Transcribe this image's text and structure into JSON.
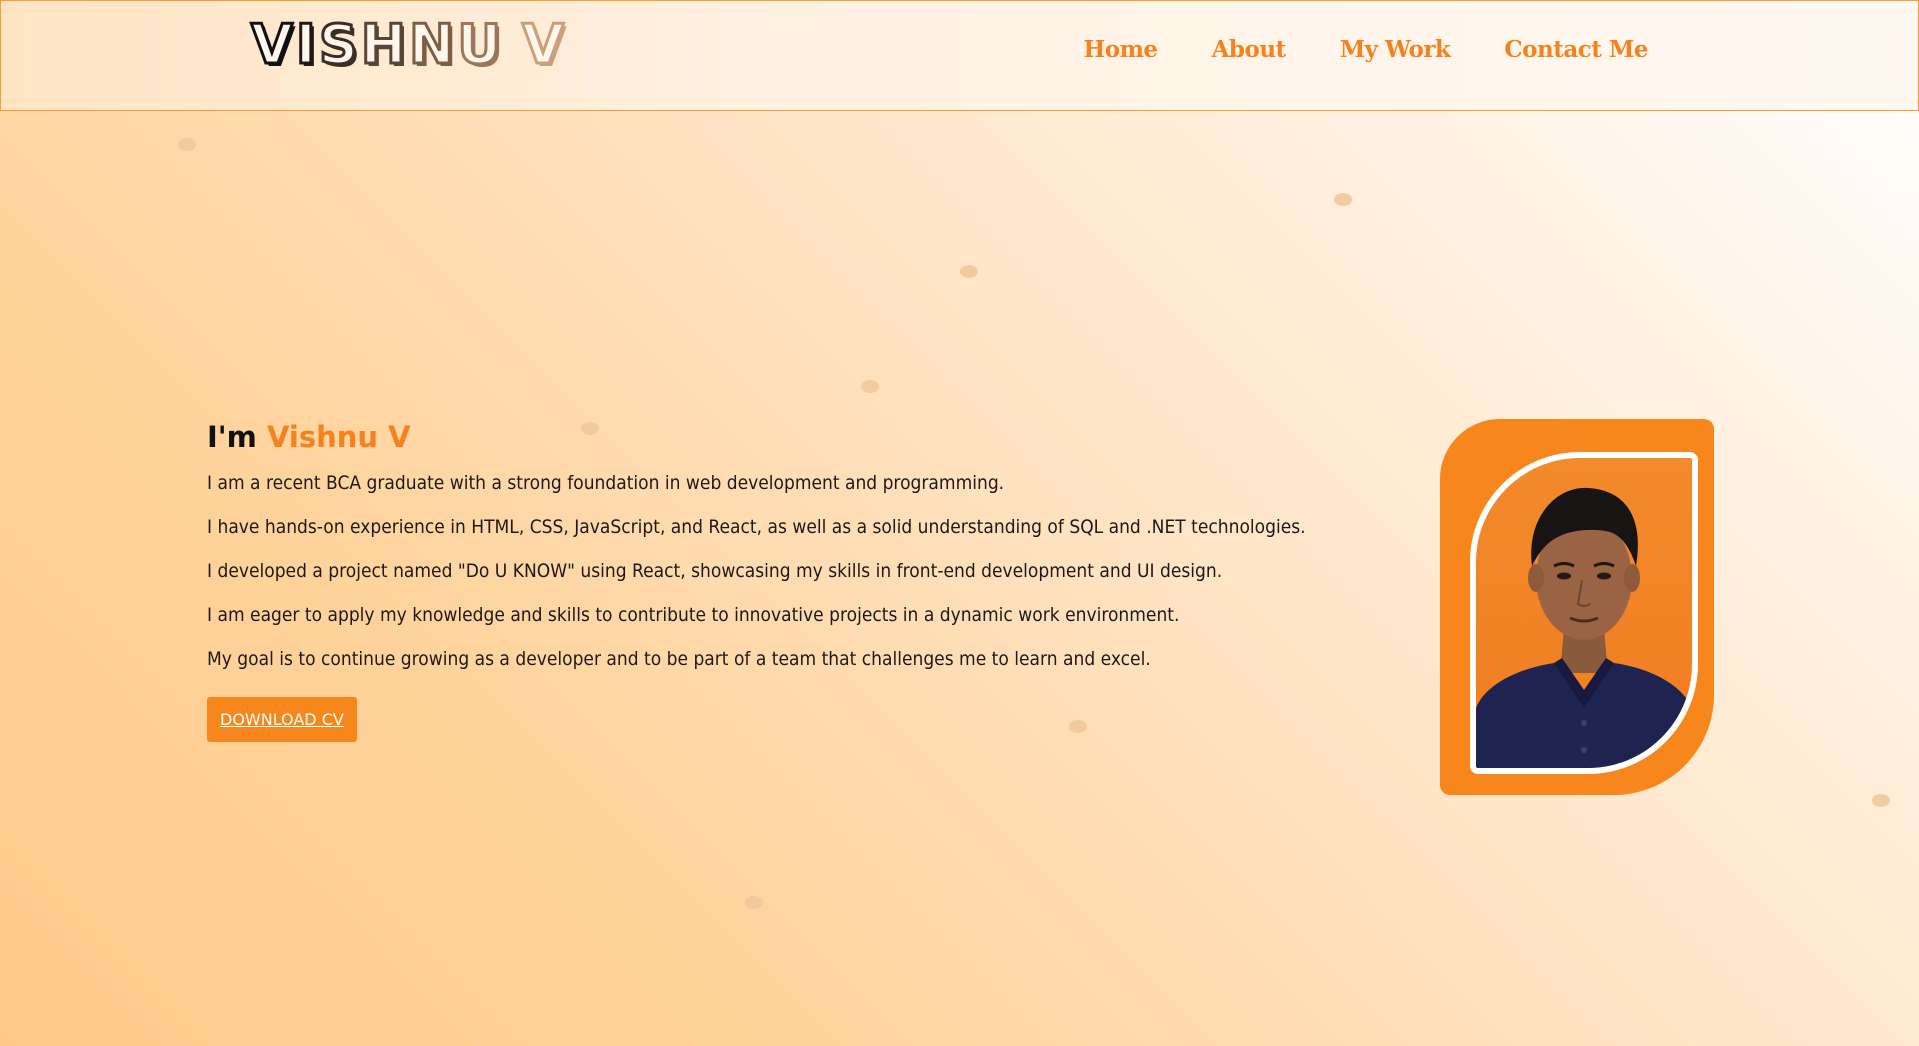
{
  "header": {
    "logo_letters": [
      "V",
      "I",
      "S",
      "H",
      "N",
      "U",
      " ",
      "V"
    ],
    "logo_colors": [
      "#111111",
      "#1e1a17",
      "#3a2e25",
      "#5a4534",
      "#7d5e44",
      "#9b7657",
      "#ffffff",
      "#c9a07a"
    ],
    "nav": [
      {
        "label": "Home"
      },
      {
        "label": "About"
      },
      {
        "label": "My Work"
      },
      {
        "label": "Contact Me"
      }
    ]
  },
  "hero": {
    "greeting": "I'm",
    "name": "Vishnu V",
    "paragraphs": [
      "I am a recent BCA graduate with a strong foundation in web development and programming.",
      "I have hands-on experience in HTML, CSS, JavaScript, and React, as well as a solid understanding of SQL and .NET technologies.",
      "I developed a project named \"Do U KNOW\" using React, showcasing my skills in front-end development and UI design.",
      "I am eager to apply my knowledge and skills to contribute to innovative projects in a dynamic work environment.",
      "My goal is to continue growing as a developer and to be part of a team that challenges me to learn and excel."
    ],
    "cv_button": "DOWNLOAD CV"
  },
  "colors": {
    "accent": "#f7871c",
    "text": "#1a1a1a",
    "dots": "#f0c79a"
  }
}
